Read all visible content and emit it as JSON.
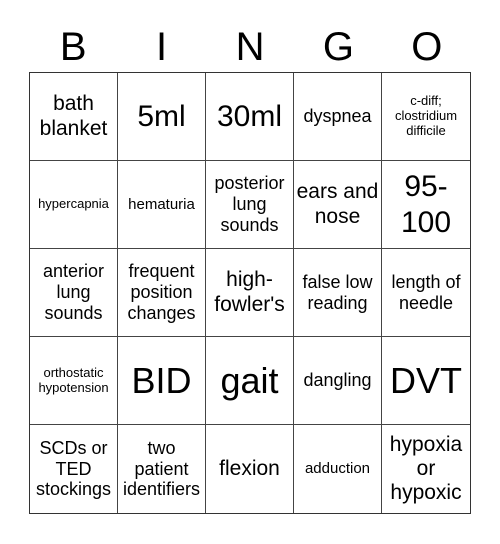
{
  "header": {
    "letters": [
      "B",
      "I",
      "N",
      "G",
      "O"
    ]
  },
  "cells": [
    [
      "bath blanket",
      "5ml",
      "30ml",
      "dyspnea",
      "c-diff; clostridium difficile"
    ],
    [
      "hypercapnia",
      "hematuria",
      "posterior lung sounds",
      "ears and nose",
      "95-100"
    ],
    [
      "anterior lung sounds",
      "frequent position changes",
      "high-fowler's",
      "false low reading",
      "length of needle"
    ],
    [
      "orthostatic hypotension",
      "BID",
      "gait",
      "dangling",
      "DVT"
    ],
    [
      "SCDs or TED stockings",
      "two patient identifiers",
      "flexion",
      "adduction",
      "hypoxia or hypoxic"
    ]
  ]
}
